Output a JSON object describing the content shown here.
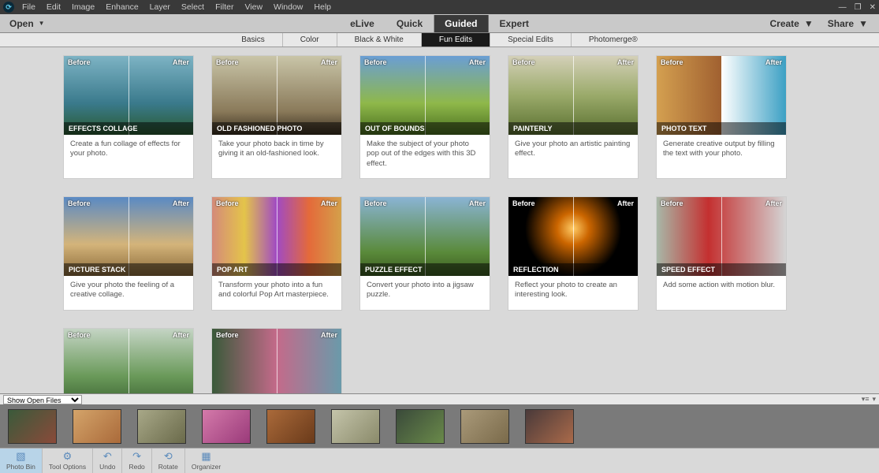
{
  "menus": [
    "File",
    "Edit",
    "Image",
    "Enhance",
    "Layer",
    "Select",
    "Filter",
    "View",
    "Window",
    "Help"
  ],
  "open_label": "Open",
  "modes": {
    "elive": "eLive",
    "quick": "Quick",
    "guided": "Guided",
    "expert": "Expert"
  },
  "create_label": "Create",
  "share_label": "Share",
  "subtabs": [
    "Basics",
    "Color",
    "Black & White",
    "Fun Edits",
    "Special Edits",
    "Photomerge®"
  ],
  "before": "Before",
  "after": "After",
  "cards": [
    {
      "title": "EFFECTS COLLAGE",
      "desc": "Create a fun collage of effects for your photo.",
      "cls": "img1"
    },
    {
      "title": "OLD FASHIONED PHOTO",
      "desc": "Take your photo back in time by giving it an old-fashioned look.",
      "cls": "img2"
    },
    {
      "title": "OUT OF BOUNDS",
      "desc": "Make the subject of your photo pop out of the edges with this 3D effect.",
      "cls": "img3"
    },
    {
      "title": "PAINTERLY",
      "desc": "Give your photo an artistic painting effect.",
      "cls": "img4"
    },
    {
      "title": "PHOTO TEXT",
      "desc": "Generate creative output by filling the text with your photo.",
      "cls": "img5"
    },
    {
      "title": "PICTURE STACK",
      "desc": "Give your photo the feeling of a creative collage.",
      "cls": "img6"
    },
    {
      "title": "POP ART",
      "desc": "Transform your photo into a fun and colorful Pop Art masterpiece.",
      "cls": "img7"
    },
    {
      "title": "PUZZLE EFFECT",
      "desc": "Convert your photo into a jigsaw puzzle.",
      "cls": "img8"
    },
    {
      "title": "REFLECTION",
      "desc": "Reflect your photo to create an interesting look.",
      "cls": "img9"
    },
    {
      "title": "SPEED EFFECT",
      "desc": "Add some action with motion blur.",
      "cls": "img10"
    },
    {
      "title": "",
      "desc": "",
      "cls": "img11"
    },
    {
      "title": "",
      "desc": "",
      "cls": "img12"
    }
  ],
  "bin_header": "Show Open Files",
  "bottom": {
    "photo_bin": "Photo Bin",
    "tool_options": "Tool Options",
    "undo": "Undo",
    "redo": "Redo",
    "rotate": "Rotate",
    "organizer": "Organizer"
  }
}
